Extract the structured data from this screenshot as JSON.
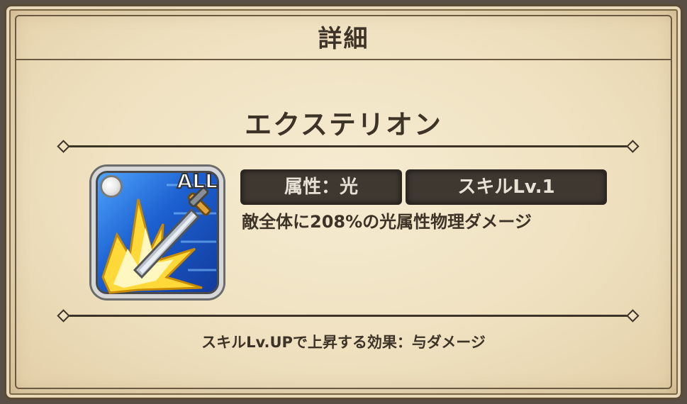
{
  "header": {
    "title": "詳細"
  },
  "skill": {
    "name": "エクステリオン",
    "icon_badge": "ALL",
    "attribute_tag": "属性：光",
    "level_tag": "スキルLv.1",
    "description": "敵全体に208%の光属性物理ダメージ",
    "icon": "sword-light-burst-icon"
  },
  "footer": {
    "levelup_effect": "スキルLv.UPで上昇する効果：与ダメージ"
  },
  "colors": {
    "parchment": "#efe1c0",
    "border": "#6b5a3f",
    "text": "#3d3327",
    "tag_bg": "#3f3831",
    "icon_blue": "#1c5fcf",
    "burst_yellow": "#ffd83a"
  }
}
